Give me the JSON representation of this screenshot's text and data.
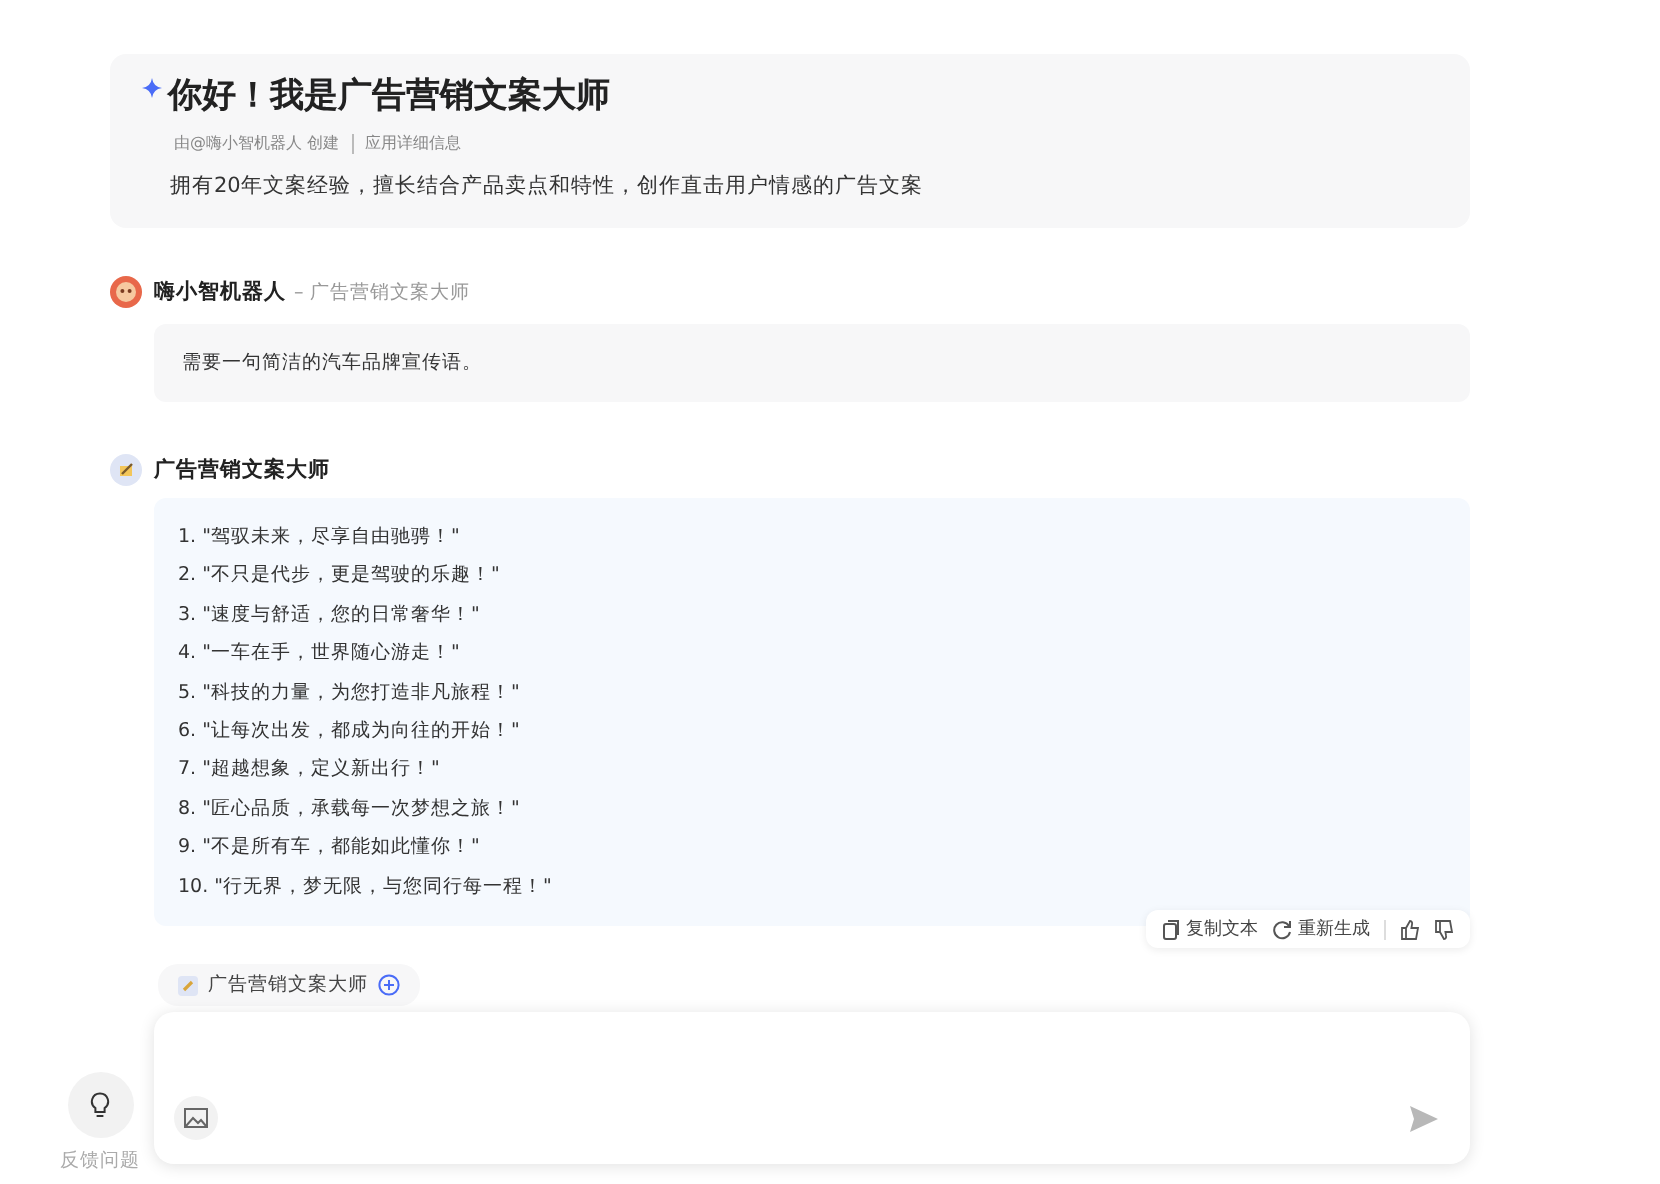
{
  "intro": {
    "title": "你好！我是广告营销文案大师",
    "creator": "由@嗨小智机器人 创建",
    "details_link": "应用详细信息",
    "description": "拥有20年文案经验，擅长结合产品卖点和特性，创作直击用户情感的广告文案"
  },
  "messages": [
    {
      "kind": "user",
      "author": "嗨小智机器人",
      "context": "– 广告营销文案大师",
      "text": "需要一句简洁的汽车品牌宣传语。"
    },
    {
      "kind": "bot",
      "author": "广告营销文案大师",
      "items": [
        "1. \"驾驭未来，尽享自由驰骋！\"",
        "2. \"不只是代步，更是驾驶的乐趣！\"",
        "3. \"速度与舒适，您的日常奢华！\"",
        "4. \"一车在手，世界随心游走！\"",
        "5. \"科技的力量，为您打造非凡旅程！\"",
        "6. \"让每次出发，都成为向往的开始！\"",
        "7. \"超越想象，定义新出行！\"",
        "8. \"匠心品质，承载每一次梦想之旅！\"",
        "9. \"不是所有车，都能如此懂你！\"",
        "10. \"行无界，梦无限，与您同行每一程！\""
      ],
      "actions": [
        "复制文本",
        "重新生成"
      ]
    }
  ],
  "composer": {
    "agent_chip": "广告营销文案大师"
  },
  "feedback": {
    "label": "反馈问题"
  }
}
